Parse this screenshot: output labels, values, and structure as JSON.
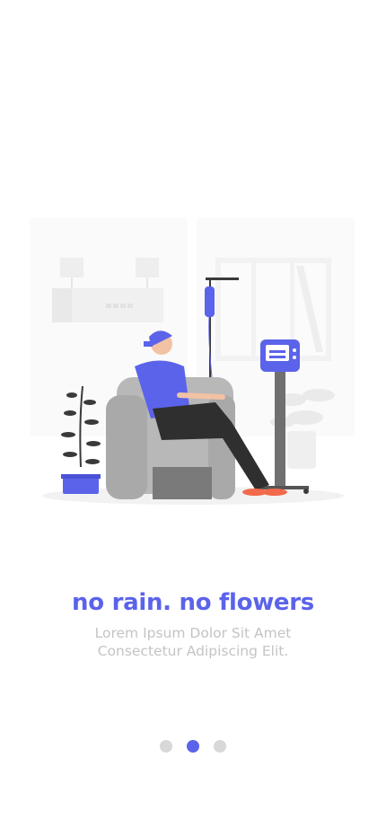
{
  "colors": {
    "accent": "#5b63ea",
    "subtitle": "#c4c4c4",
    "dot_inactive": "#d8d8d8",
    "background": "#ffffff"
  },
  "illustration": {
    "icon": "chemotherapy-patient-illustration"
  },
  "onboarding": {
    "title": "no rain. no flowers",
    "subtitle_line1": "Lorem Ipsum Dolor Sit Amet",
    "subtitle_line2": "Consectetur Adipiscing Elit."
  },
  "pagination": {
    "total": 3,
    "active_index": 1
  }
}
